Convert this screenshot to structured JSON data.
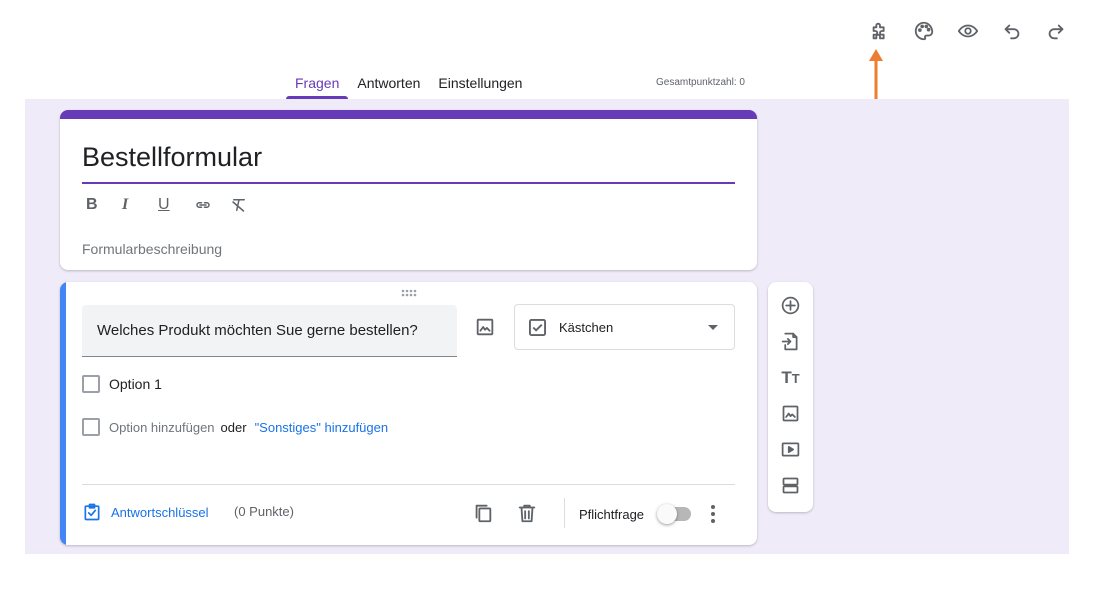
{
  "topbar": {
    "icons": [
      "puzzle-addons-icon",
      "palette-icon",
      "eye-preview-icon",
      "undo-icon",
      "redo-icon"
    ],
    "annotation_arrow_color": "#ed7d31"
  },
  "tabs": [
    {
      "label": "Fragen",
      "active": true
    },
    {
      "label": "Antworten",
      "active": false
    },
    {
      "label": "Einstellungen",
      "active": false
    }
  ],
  "total_points": "Gesamtpunktzahl: 0",
  "colors": {
    "accent": "#673ab7",
    "canvas_bg": "#efebf8",
    "focus_bar": "#4285f4",
    "link": "#1a73e8"
  },
  "form": {
    "title": "Bestellformular",
    "description_placeholder": "Formularbeschreibung",
    "format_tools": [
      "bold-icon",
      "italic-icon",
      "underline-icon",
      "link-icon",
      "clear-format-icon"
    ]
  },
  "question": {
    "text": "Welches Produkt möchten Sue gerne bestellen?",
    "type": "Kästchen",
    "options": [
      "Option 1"
    ],
    "add_option": "Option hinzufügen",
    "or_text": "oder",
    "add_other": "\"Sonstiges\" hinzufügen",
    "answer_key": "Antwortschlüssel",
    "points": "(0 Punkte)",
    "required_label": "Pflichtfrage",
    "required": false
  },
  "side_toolbar": [
    "add-question-icon",
    "import-questions-icon",
    "title-text-icon",
    "add-image-icon",
    "add-video-icon",
    "add-section-icon"
  ]
}
